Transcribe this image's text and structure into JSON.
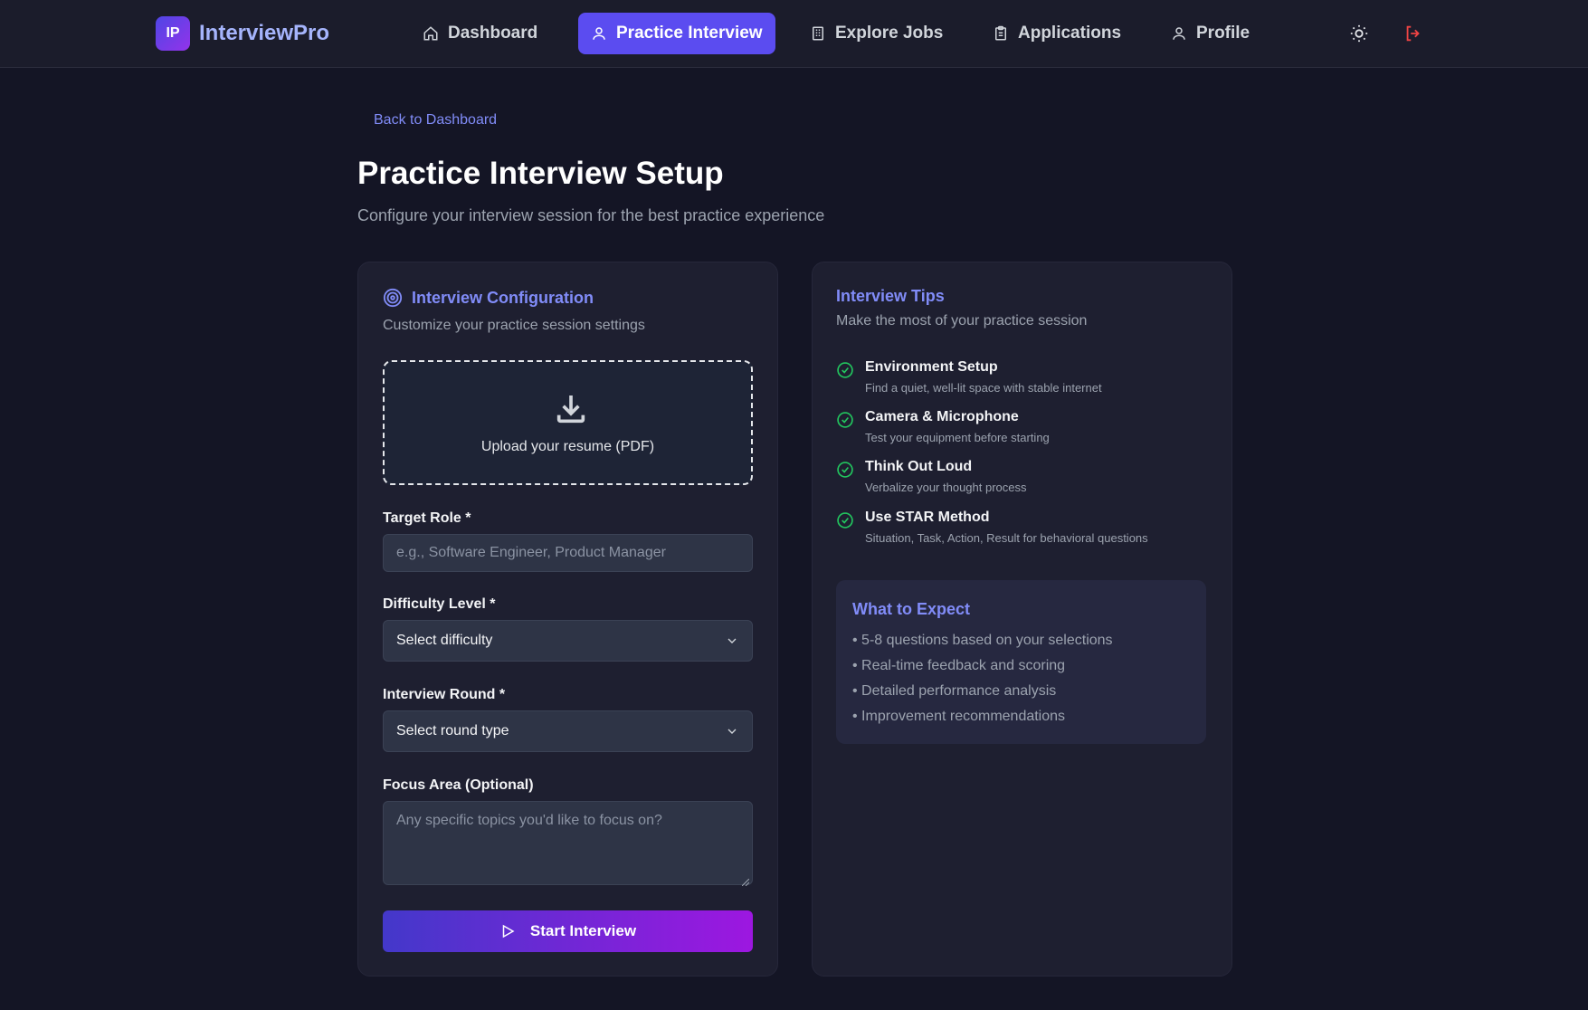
{
  "app": {
    "logo_initials": "IP",
    "name": "InterviewPro"
  },
  "nav": {
    "items": [
      {
        "label": "Dashboard",
        "icon": "home-icon"
      },
      {
        "label": "Practice Interview",
        "icon": "user-icon",
        "active": true
      },
      {
        "label": "Explore Jobs",
        "icon": "building-icon"
      },
      {
        "label": "Applications",
        "icon": "clipboard-icon"
      },
      {
        "label": "Profile",
        "icon": "user-icon"
      }
    ],
    "theme_icon": "sun-icon",
    "logout_icon": "logout-icon"
  },
  "header": {
    "back_link": "Back to Dashboard",
    "title": "Practice Interview Setup",
    "subtitle": "Configure your interview session for the best practice experience"
  },
  "config": {
    "title": "Interview Configuration",
    "subtitle": "Customize your practice session settings",
    "upload_text": "Upload your resume (PDF)",
    "target_role_label": "Target Role *",
    "target_role_placeholder": "e.g., Software Engineer, Product Manager",
    "difficulty_label": "Difficulty Level *",
    "difficulty_value": "Select difficulty",
    "round_label": "Interview Round *",
    "round_value": "Select round type",
    "focus_label": "Focus Area (Optional)",
    "focus_placeholder": "Any specific topics you'd like to focus on?",
    "start_button": "Start Interview"
  },
  "tips": {
    "title": "Interview Tips",
    "subtitle": "Make the most of your practice session",
    "items": [
      {
        "title": "Environment Setup",
        "desc": "Find a quiet, well-lit space with stable internet"
      },
      {
        "title": "Camera & Microphone",
        "desc": "Test your equipment before starting"
      },
      {
        "title": "Think Out Loud",
        "desc": "Verbalize your thought process"
      },
      {
        "title": "Use STAR Method",
        "desc": "Situation, Task, Action, Result for behavioral questions"
      }
    ]
  },
  "expect": {
    "title": "What to Expect",
    "items": [
      "• 5-8 questions based on your selections",
      "• Real-time feedback and scoring",
      "• Detailed performance analysis",
      "• Improvement recommendations"
    ]
  },
  "colors": {
    "accent": "#818cf8",
    "primary": "#5b4cf0",
    "success": "#22c55e",
    "danger": "#ef4444",
    "background": "#141525"
  }
}
